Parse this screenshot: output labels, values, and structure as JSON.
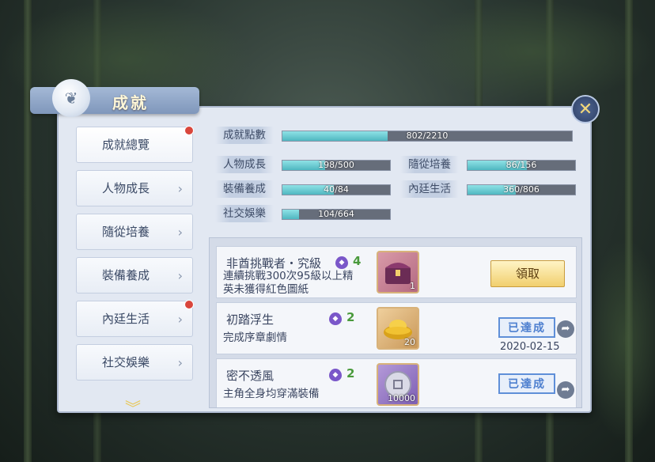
{
  "title": "成就",
  "sidebar": {
    "items": [
      {
        "label": "成就總覽",
        "red_dot": true
      },
      {
        "label": "人物成長"
      },
      {
        "label": "隨從培養"
      },
      {
        "label": "裝備養成"
      },
      {
        "label": "內廷生活",
        "red_dot": true
      },
      {
        "label": "社交娛樂"
      }
    ]
  },
  "stats": {
    "total": {
      "label": "成就點數",
      "value": "802/2210",
      "fraction": 0.363
    },
    "categories": [
      {
        "label": "人物成長",
        "value": "198/500",
        "fraction": 0.396
      },
      {
        "label": "隨從培養",
        "value": "86/156",
        "fraction": 0.551
      },
      {
        "label": "裝備養成",
        "value": "40/84",
        "fraction": 0.476
      },
      {
        "label": "內廷生活",
        "value": "360/806",
        "fraction": 0.447
      },
      {
        "label": "社交娛樂",
        "value": "104/664",
        "fraction": 0.157
      }
    ]
  },
  "achievements": [
    {
      "name": "非酋挑戰者・究級",
      "points": "4",
      "desc_line1": "連續挑戰300次95級以上精",
      "desc_line2": "英未獲得紅色圖紙",
      "reward_qty": "1",
      "action": "領取"
    },
    {
      "name": "初踏浮生",
      "points": "2",
      "desc_line1": "完成序章劇情",
      "reward_qty": "20",
      "status": "已達成",
      "date": "2020-02-15"
    },
    {
      "name": "密不透風",
      "points": "2",
      "desc_line1": "主角全身均穿滿裝備",
      "reward_qty": "10000",
      "status": "已達成"
    }
  ],
  "icons": {
    "close": "close-icon",
    "gem": "achievement-gem-icon",
    "share": "share-icon",
    "chevron": "chevron-right-icon"
  },
  "colors": {
    "bar_fill": "#5cc3cb",
    "bar_bg": "#666d7a",
    "points": "#4a9a3c",
    "stamp": "#4d7fcf"
  }
}
